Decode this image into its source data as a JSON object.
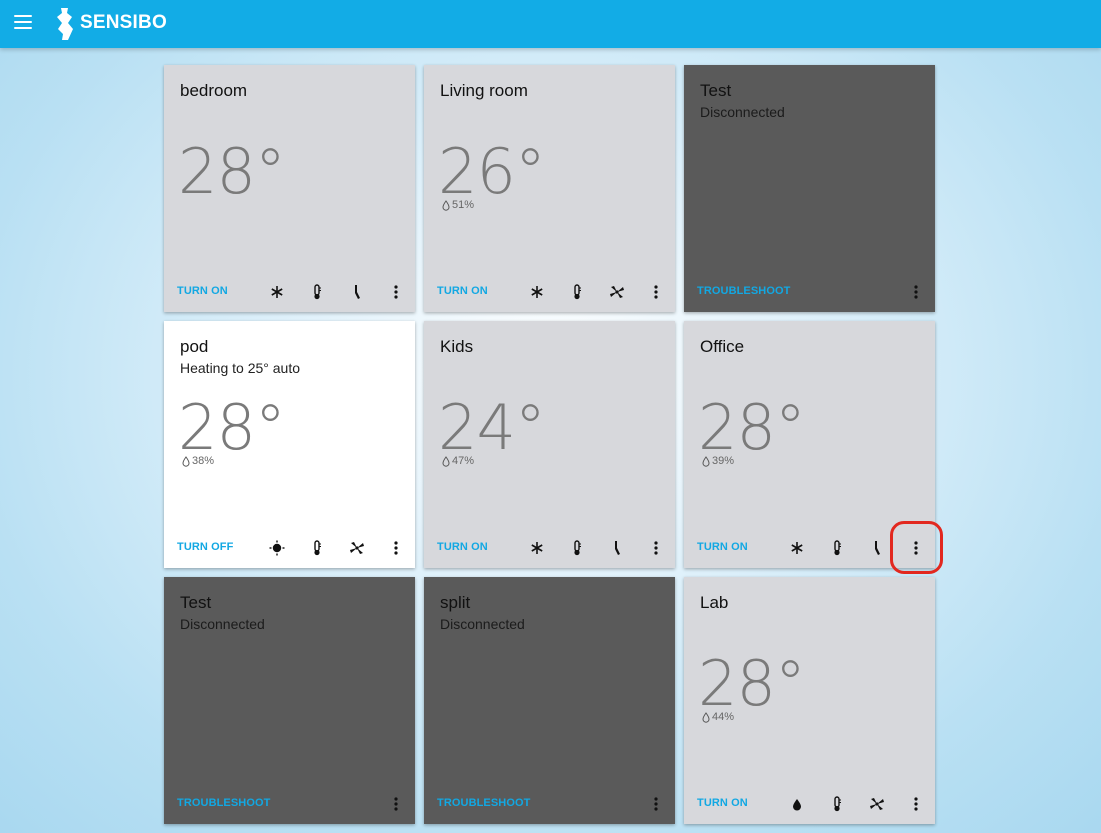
{
  "app": {
    "brand": "SENSIBO"
  },
  "colors": {
    "header": "#12ace6",
    "accent": "#12a8e3",
    "card_off": "#d7d8dc",
    "card_on": "#ffffff",
    "card_disconnected": "#5a5a5a",
    "highlight": "#e2281f"
  },
  "cards": [
    {
      "name": "bedroom",
      "status": "",
      "temp": "28°",
      "humidity": "",
      "action": "TURN ON",
      "icons": [
        "snowflake-icon",
        "thermometer-icon",
        "swing-icon",
        "more-icon"
      ]
    },
    {
      "name": "Living room",
      "status": "",
      "temp": "26°",
      "humidity": "51%",
      "action": "TURN ON",
      "icons": [
        "snowflake-icon",
        "thermometer-icon",
        "fan-icon",
        "more-icon"
      ]
    },
    {
      "name": "Test",
      "status": "Disconnected",
      "temp": "",
      "humidity": "",
      "action": "TROUBLESHOOT",
      "icons": [
        "more-icon"
      ]
    },
    {
      "name": "pod",
      "status": "Heating to 25° auto",
      "temp": "28°",
      "humidity": "38%",
      "action": "TURN OFF",
      "icons": [
        "sun-icon",
        "thermometer-icon",
        "fan-icon",
        "more-icon"
      ]
    },
    {
      "name": "Kids",
      "status": "",
      "temp": "24°",
      "humidity": "47%",
      "action": "TURN ON",
      "icons": [
        "snowflake-icon",
        "thermometer-icon",
        "swing-icon",
        "more-icon"
      ]
    },
    {
      "name": "Office",
      "status": "",
      "temp": "28°",
      "humidity": "39%",
      "action": "TURN ON",
      "icons": [
        "snowflake-icon",
        "thermometer-icon",
        "swing-icon",
        "more-icon"
      ]
    },
    {
      "name": "Test",
      "status": "Disconnected",
      "temp": "",
      "humidity": "",
      "action": "TROUBLESHOOT",
      "icons": [
        "more-icon"
      ]
    },
    {
      "name": "split",
      "status": "Disconnected",
      "temp": "",
      "humidity": "",
      "action": "TROUBLESHOOT",
      "icons": [
        "more-icon"
      ]
    },
    {
      "name": "Lab",
      "status": "",
      "temp": "28°",
      "humidity": "44%",
      "action": "TURN ON",
      "icons": [
        "drop-icon",
        "thermometer-icon",
        "fan-icon",
        "more-icon"
      ]
    }
  ]
}
